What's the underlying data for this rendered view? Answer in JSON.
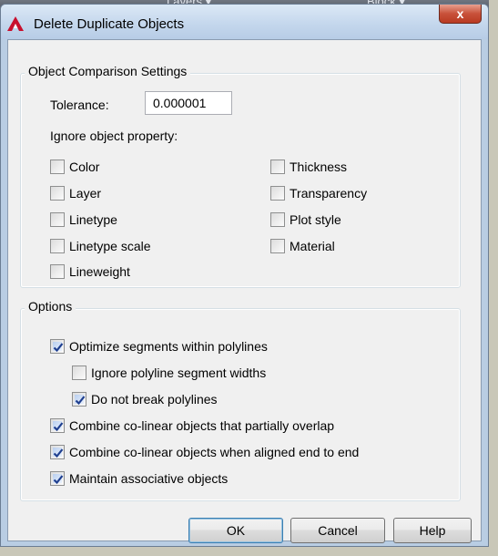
{
  "background": {
    "left_text": "Layers ▾",
    "right_text": "Block ▾"
  },
  "dialog": {
    "title": "Delete Duplicate Objects",
    "close_label": "x"
  },
  "comparison": {
    "legend": "Object Comparison Settings",
    "tolerance_label": "Tolerance:",
    "tolerance_value": "0.000001",
    "ignore_label": "Ignore object property:",
    "properties_left": [
      {
        "label": "Color",
        "checked": false
      },
      {
        "label": "Layer",
        "checked": false
      },
      {
        "label": "Linetype",
        "checked": false
      },
      {
        "label": "Linetype scale",
        "checked": false
      },
      {
        "label": "Lineweight",
        "checked": false
      }
    ],
    "properties_right": [
      {
        "label": "Thickness",
        "checked": false
      },
      {
        "label": "Transparency",
        "checked": false
      },
      {
        "label": "Plot style",
        "checked": false
      },
      {
        "label": "Material",
        "checked": false
      }
    ]
  },
  "options": {
    "legend": "Options",
    "items": [
      {
        "label": "Optimize segments within polylines",
        "checked": true
      },
      {
        "label": "Ignore polyline segment widths",
        "checked": false
      },
      {
        "label": "Do not break polylines",
        "checked": true
      },
      {
        "label": "Combine co-linear objects that partially overlap",
        "checked": true
      },
      {
        "label": "Combine co-linear objects when aligned end to end",
        "checked": true
      },
      {
        "label": "Maintain associative objects",
        "checked": true
      }
    ]
  },
  "buttons": {
    "ok": "OK",
    "cancel": "Cancel",
    "help": "Help"
  },
  "colors": {
    "accent_red": "#c8102e",
    "check_blue": "#1f3f8f",
    "close_red": "#c8513a"
  },
  "icons": {
    "app": "autocad-icon",
    "close": "close-icon",
    "check": "check-icon"
  }
}
